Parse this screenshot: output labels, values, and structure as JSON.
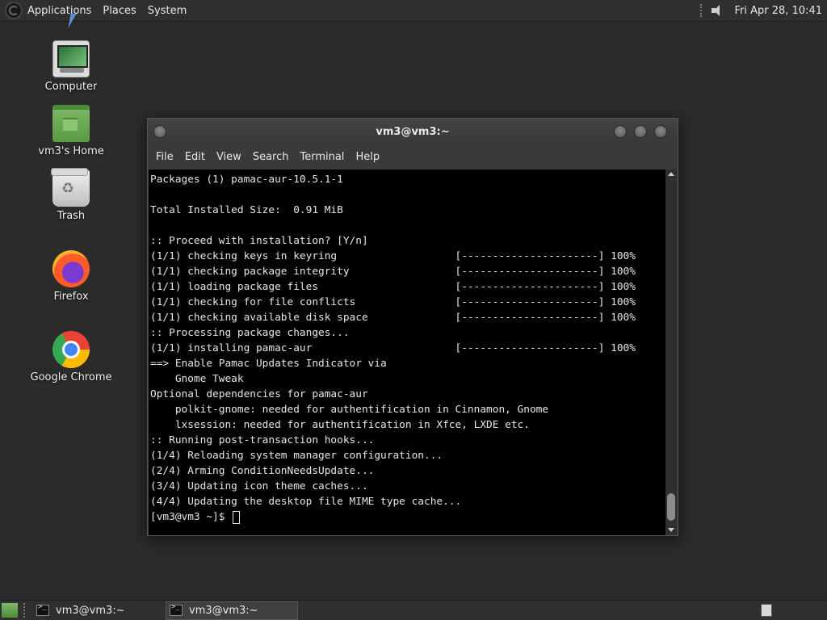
{
  "top_panel": {
    "menus": [
      "Applications",
      "Places",
      "System"
    ],
    "clock": "Fri Apr 28, 10:41"
  },
  "desktop_icons": [
    {
      "label": "Computer",
      "icon": "computer-icon"
    },
    {
      "label": "vm3's Home",
      "icon": "home-folder-icon"
    },
    {
      "label": "Trash",
      "icon": "trash-icon"
    },
    {
      "label": "Firefox",
      "icon": "firefox-icon"
    },
    {
      "label": "Google Chrome",
      "icon": "chrome-icon"
    }
  ],
  "terminal": {
    "title": "vm3@vm3:~",
    "menus": [
      "File",
      "Edit",
      "View",
      "Search",
      "Terminal",
      "Help"
    ],
    "lines": [
      "Packages (1) pamac-aur-10.5.1-1",
      "",
      "Total Installed Size:  0.91 MiB",
      "",
      ":: Proceed with installation? [Y/n]",
      "(1/1) checking keys in keyring                   [----------------------] 100%",
      "(1/1) checking package integrity                 [----------------------] 100%",
      "(1/1) loading package files                      [----------------------] 100%",
      "(1/1) checking for file conflicts                [----------------------] 100%",
      "(1/1) checking available disk space              [----------------------] 100%",
      ":: Processing package changes...",
      "(1/1) installing pamac-aur                       [----------------------] 100%",
      "==> Enable Pamac Updates Indicator via",
      "    Gnome Tweak",
      "Optional dependencies for pamac-aur",
      "    polkit-gnome: needed for authentification in Cinnamon, Gnome",
      "    lxsession: needed for authentification in Xfce, LXDE etc.",
      ":: Running post-transaction hooks...",
      "(1/4) Reloading system manager configuration...",
      "(2/4) Arming ConditionNeedsUpdate...",
      "(3/4) Updating icon theme caches...",
      "(4/4) Updating the desktop file MIME type cache..."
    ],
    "prompt": "[vm3@vm3 ~]$ "
  },
  "taskbar": {
    "tasks": [
      {
        "label": "vm3@vm3:~",
        "active": false
      },
      {
        "label": "vm3@vm3:~",
        "active": true
      }
    ]
  }
}
